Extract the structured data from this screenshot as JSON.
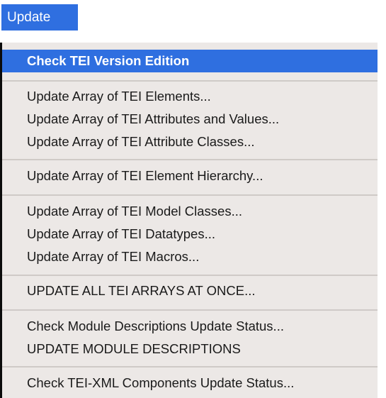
{
  "menubar": {
    "title": "Update"
  },
  "menu": {
    "items": [
      "Check TEI Version Edition",
      "Update Array of TEI Elements...",
      "Update Array of TEI Attributes and Values...",
      "Update Array of TEI Attribute Classes...",
      "Update Array of TEI Element Hierarchy...",
      "Update Array of TEI Model Classes...",
      "Update Array of TEI Datatypes...",
      "Update Array of TEI Macros...",
      "UPDATE ALL TEI ARRAYS AT ONCE...",
      "Check Module Descriptions Update Status...",
      "UPDATE MODULE DESCRIPTIONS",
      "Check TEI-XML Components Update Status..."
    ],
    "highlighted_item": "Check TEI Version Edition"
  },
  "colors": {
    "accent": "#2f6fe0",
    "menu_background": "#ece8e6",
    "separator": "#cfcac7"
  }
}
